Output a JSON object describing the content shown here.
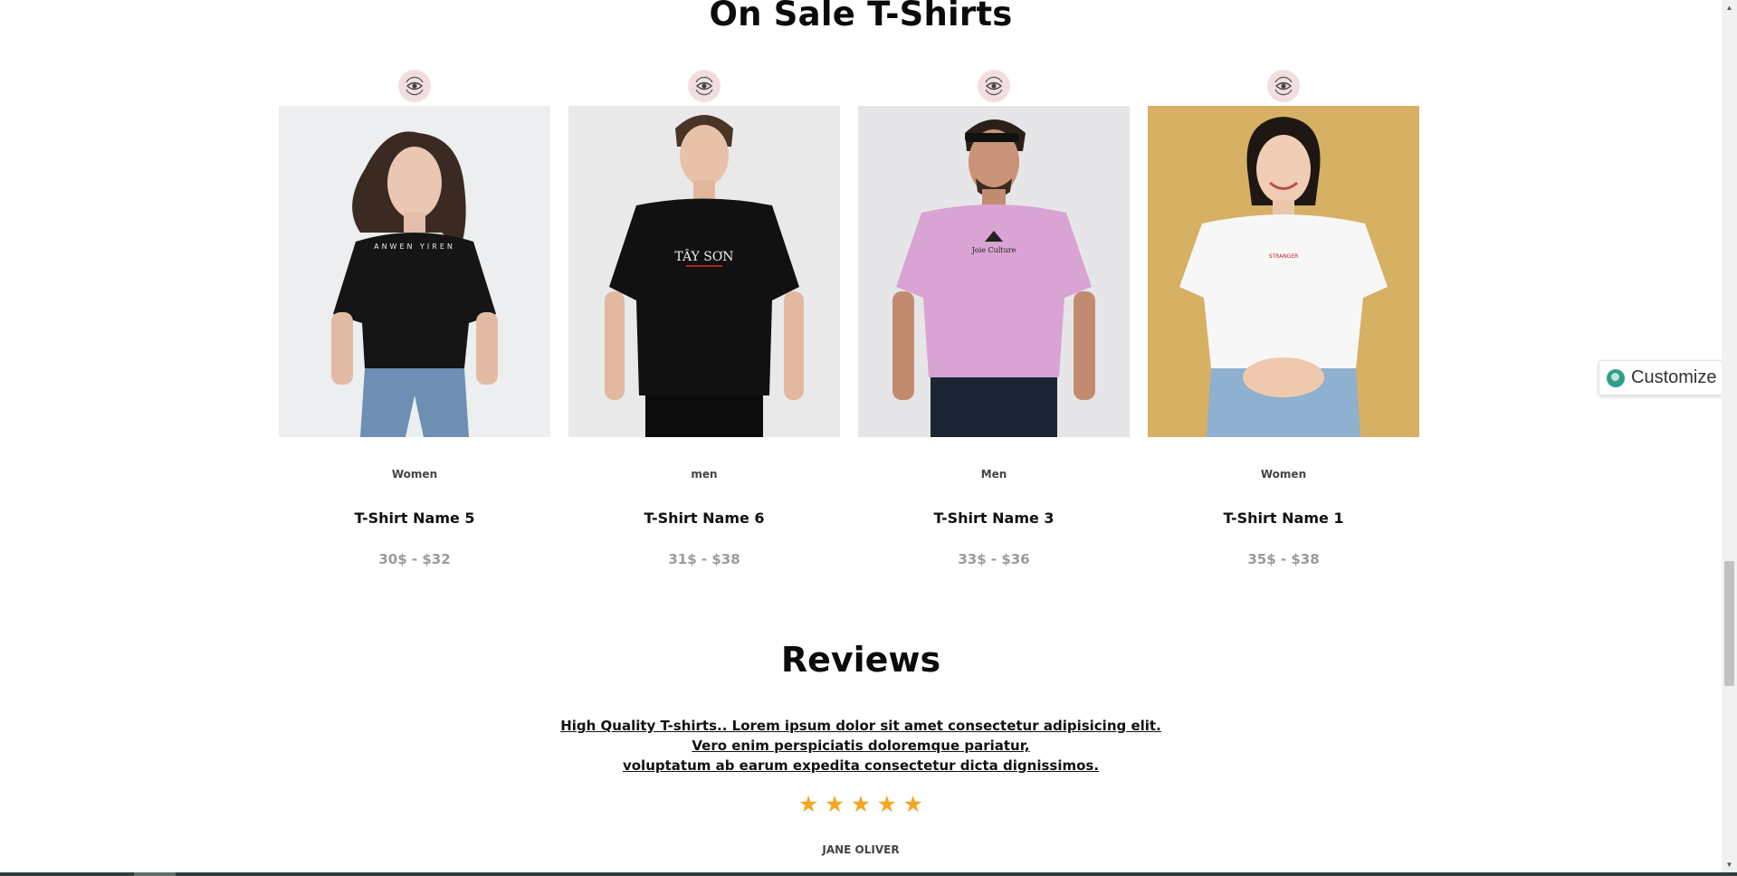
{
  "sections": {
    "sale_title": "On Sale T-Shirts",
    "reviews_title": "Reviews"
  },
  "products": [
    {
      "category": "Women",
      "name": "T-Shirt Name 5",
      "price": "30$ - $32",
      "quickview_icon": "eye-icon"
    },
    {
      "category": "men",
      "name": "T-Shirt Name 6",
      "price": "31$ - $38",
      "quickview_icon": "eye-icon"
    },
    {
      "category": "Men",
      "name": "T-Shirt Name 3",
      "price": "33$ - $36",
      "quickview_icon": "eye-icon"
    },
    {
      "category": "Women",
      "name": "T-Shirt Name 1",
      "price": "35$ - $38",
      "quickview_icon": "eye-icon"
    }
  ],
  "review": {
    "lines": [
      "High Quality T-shirts.. Lorem ipsum dolor sit amet consectetur adipisicing elit.",
      "Vero enim perspiciatis doloremque pariatur,",
      "voluptatum ab earum expedita consectetur dicta dignissimos."
    ],
    "rating": 5,
    "star_glyph": "★",
    "reviewer": "JANE OLIVER"
  },
  "customize": {
    "label": "Customize"
  },
  "colors": {
    "accent_star": "#f5a623",
    "quickview_bg": "#f2dede",
    "price": "#9b9b9b"
  }
}
